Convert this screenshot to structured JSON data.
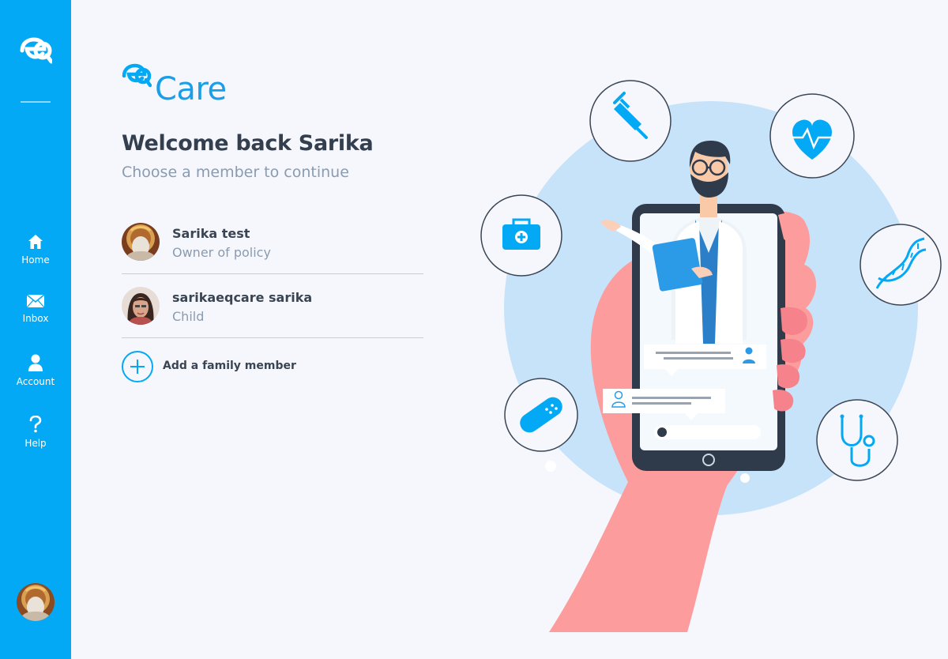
{
  "sidebar": {
    "nav": [
      {
        "label": "Home",
        "icon": "home-icon"
      },
      {
        "label": "Inbox",
        "icon": "mail-icon"
      },
      {
        "label": "Account",
        "icon": "user-icon"
      },
      {
        "label": "Help",
        "icon": "help-icon"
      }
    ]
  },
  "brand": {
    "name": "Care"
  },
  "header": {
    "welcome": "Welcome back Sarika",
    "subtitle": "Choose a member to continue"
  },
  "members": [
    {
      "name": "Sarika test",
      "role": "Owner of policy"
    },
    {
      "name": "sarikaeqcare sarika",
      "role": "Child"
    }
  ],
  "add_member": {
    "label": "Add a family member"
  },
  "colors": {
    "primary": "#03a9f4",
    "brand_text": "#1a9ee6",
    "heading": "#333f4f",
    "muted": "#8a9bb0",
    "hand": "#fc9c9c",
    "circle": "#c7e3fa"
  }
}
